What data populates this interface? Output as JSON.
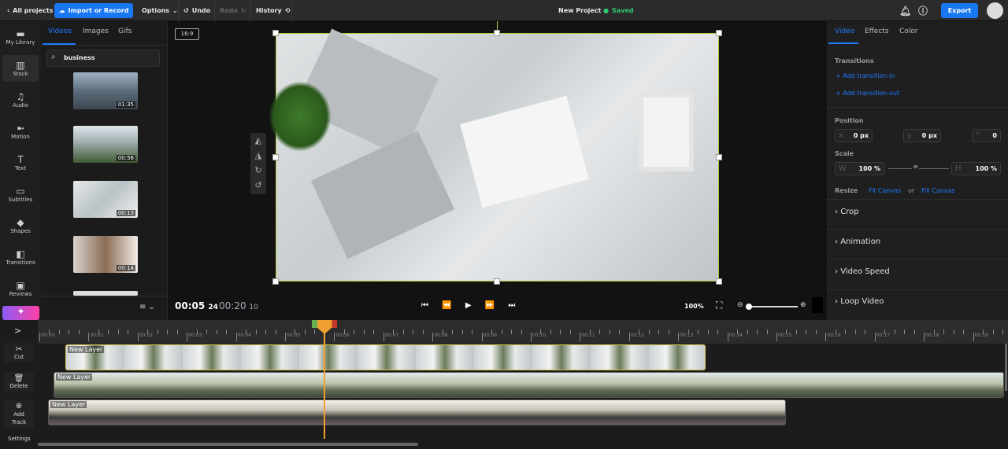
{
  "topbar": {
    "back": "All projects",
    "import": "Import or Record",
    "options": "Options",
    "undo": "Undo",
    "redo": "Redo",
    "history": "History",
    "project": "New Project",
    "status": "Saved",
    "export": "Export"
  },
  "rail": [
    {
      "label": "My Library",
      "icon": "folder-icon"
    },
    {
      "label": "Stock",
      "icon": "stock-icon"
    },
    {
      "label": "Audio",
      "icon": "music-icon"
    },
    {
      "label": "Motion",
      "icon": "motion-icon"
    },
    {
      "label": "Text",
      "icon": "text-icon"
    },
    {
      "label": "Subtitles",
      "icon": "subtitles-icon"
    },
    {
      "label": "Shapes",
      "icon": "shapes-icon"
    },
    {
      "label": "Transitions",
      "icon": "transitions-icon"
    },
    {
      "label": "Reviews",
      "icon": "reviews-icon"
    }
  ],
  "library": {
    "tabs": [
      "Videos",
      "Images",
      "Gifs"
    ],
    "search": "business",
    "thumbs": [
      {
        "dur": "01:35"
      },
      {
        "dur": "00:58"
      },
      {
        "dur": "00:13"
      },
      {
        "dur": "00:14"
      }
    ]
  },
  "preview": {
    "aspect": "16:9",
    "current": "00:05",
    "current_frames": "24",
    "total": "00:20",
    "total_frames": "10",
    "zoom": "100%"
  },
  "right": {
    "tabs": [
      "Video",
      "Effects",
      "Color"
    ],
    "transitions": "Transitions",
    "add_in": "+ Add transition in",
    "add_out": "+ Add transition out",
    "position": "Position",
    "x_label": "x",
    "x": "0 px",
    "y_label": "y",
    "y": "0 px",
    "rot_label": "°",
    "rotation": "0",
    "scale": "Scale",
    "w_label": "W",
    "w": "100 %",
    "h_label": "H",
    "h": "100 %",
    "resize": "Resize",
    "fit": "Fit Canvas",
    "or": "or",
    "fill": "Fill Canvas",
    "sections": [
      "Crop",
      "Animation",
      "Video Speed",
      "Loop Video"
    ]
  },
  "timeline": {
    "tools": {
      "expand": ">",
      "cut": "Cut",
      "delete": "Delete",
      "add_track": "Add Track",
      "settings": "Settings"
    },
    "ticks": [
      "00:00",
      "00:01",
      "00:02",
      "00:03",
      "00:04",
      "00:05",
      "00:06",
      "00:07",
      "00:08",
      "00:09",
      "00:10",
      "00:11",
      "00:12",
      "00:13",
      "00:14",
      "00:15",
      "00:16",
      "00:17",
      "00:18",
      "00:19"
    ],
    "tracks": [
      {
        "name": "New Layer"
      },
      {
        "name": "New Layer"
      },
      {
        "name": "New Layer"
      }
    ]
  },
  "colors": {
    "accent": "#1877f2",
    "playhead": "#f0a030",
    "selected": "#d9c84a",
    "saved": "#2ecc71"
  }
}
